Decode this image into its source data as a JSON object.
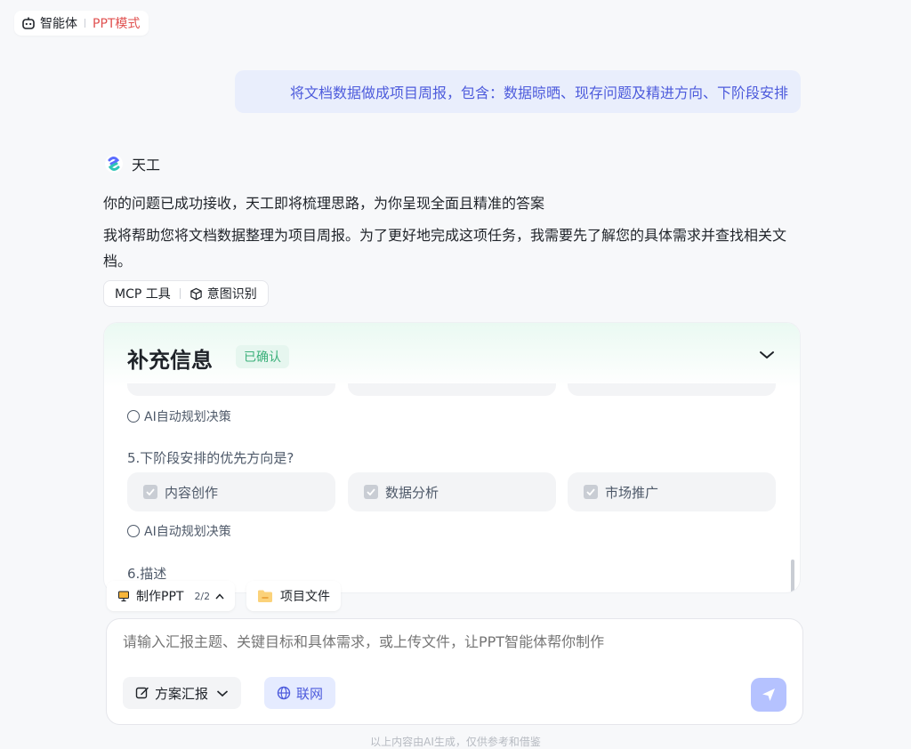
{
  "header": {
    "agent_label": "智能体",
    "mode_label": "PPT模式"
  },
  "user_message": "将文档数据做成项目周报，包含：数据晾晒、现存问题及精进方向、下阶段安排",
  "assistant": {
    "name": "天工",
    "paragraphs": [
      "你的问题已成功接收，天工即将梳理思路，为你呈现全面且精准的答案",
      "我将帮助您将文档数据整理为项目周报。为了更好地完成这项任务，我需要先了解您的具体需求并查找相关文档。"
    ],
    "tools": {
      "mcp": "MCP 工具",
      "intent": "意图识别"
    }
  },
  "supplement": {
    "title": "补充信息",
    "status": "已确认",
    "auto_option": "AI自动规划决策",
    "question5": "5.下阶段安排的优先方向是?",
    "options": [
      "内容创作",
      "数据分析",
      "市场推广"
    ],
    "question6": "6.描述"
  },
  "chips": {
    "make_ppt": "制作PPT",
    "pager": "2/2",
    "project_files": "项目文件"
  },
  "input": {
    "placeholder": "请输入汇报主题、关键目标和具体需求，或上传文件，让PPT智能体帮你制作",
    "scheme_label": "方案汇报",
    "web_label": "联网"
  },
  "footer_note": "以上内容由AI生成，仅供参考和借鉴",
  "colors": {
    "accent": "#4d5bdc",
    "mode_red": "#e0504f",
    "confirm_green": "#3bb07a"
  }
}
